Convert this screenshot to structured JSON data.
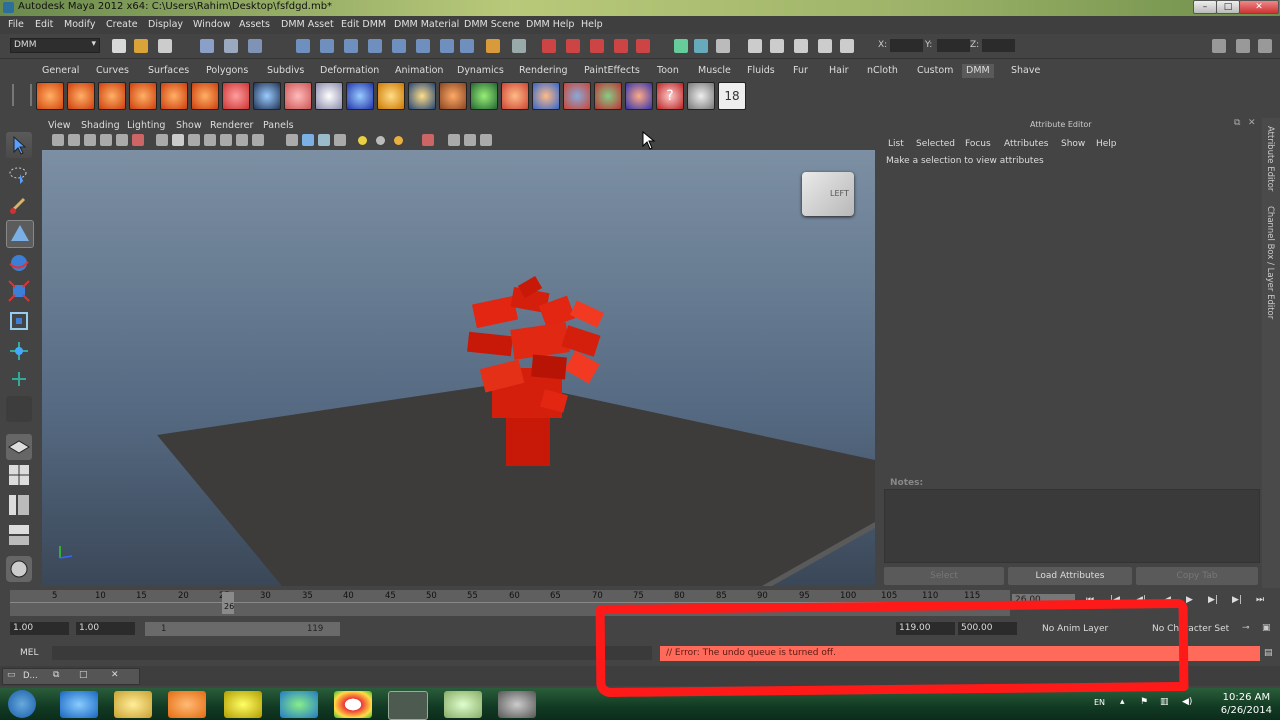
{
  "window": {
    "title": "Autodesk Maya 2012 x64: C:\\Users\\Rahim\\Desktop\\fsfdgd.mb*"
  },
  "menubar": [
    "File",
    "Edit",
    "Modify",
    "Create",
    "Display",
    "Window",
    "Assets",
    "DMM Asset",
    "Edit DMM",
    "DMM Material",
    "DMM Scene",
    "DMM Help",
    "Help"
  ],
  "status_line": {
    "menu_set": "DMM",
    "x_label": "X:",
    "y_label": "Y:",
    "z_label": "Z:"
  },
  "shelf_tabs": [
    "General",
    "Curves",
    "Surfaces",
    "Polygons",
    "Subdivs",
    "Deformation",
    "Animation",
    "Dynamics",
    "Rendering",
    "PaintEffects",
    "Toon",
    "Muscle",
    "Fluids",
    "Fur",
    "Hair",
    "nCloth",
    "Custom",
    "DMM",
    "Shave"
  ],
  "shelf_active_tab": "DMM",
  "viewport": {
    "menus": [
      "View",
      "Shading",
      "Lighting",
      "Show",
      "Renderer",
      "Panels"
    ],
    "view_cube_label": "LEFT"
  },
  "attribute_editor": {
    "title": "Attribute Editor",
    "menus": [
      "List",
      "Selected",
      "Focus",
      "Attributes",
      "Show",
      "Help"
    ],
    "message": "Make a selection to view attributes",
    "notes_label": "Notes:",
    "buttons": [
      "Select",
      "Load Attributes",
      "Copy Tab"
    ]
  },
  "side_tabs": [
    "Attribute Editor",
    "Channel Box / Layer Editor"
  ],
  "timeline": {
    "ticks": [
      "5",
      "10",
      "15",
      "20",
      "25",
      "30",
      "35",
      "40",
      "45",
      "50",
      "55",
      "60",
      "65",
      "70",
      "75",
      "80",
      "85",
      "90",
      "95",
      "100",
      "105",
      "110",
      "115"
    ],
    "current_frame": "26",
    "current_time_field": "26.00"
  },
  "range": {
    "start": "1.00",
    "start2": "1.00",
    "slider_start": "1",
    "slider_end": "119",
    "end": "119.00",
    "end2": "500.00",
    "anim_layer": "No Anim Layer",
    "character_set": "No Character Set"
  },
  "command_line": {
    "lang": "MEL",
    "error": "// Error: The undo queue is turned off."
  },
  "taskbar": {
    "time": "10:26 AM",
    "date": "6/26/2014",
    "lang": "EN",
    "minimized_window": "D..."
  }
}
